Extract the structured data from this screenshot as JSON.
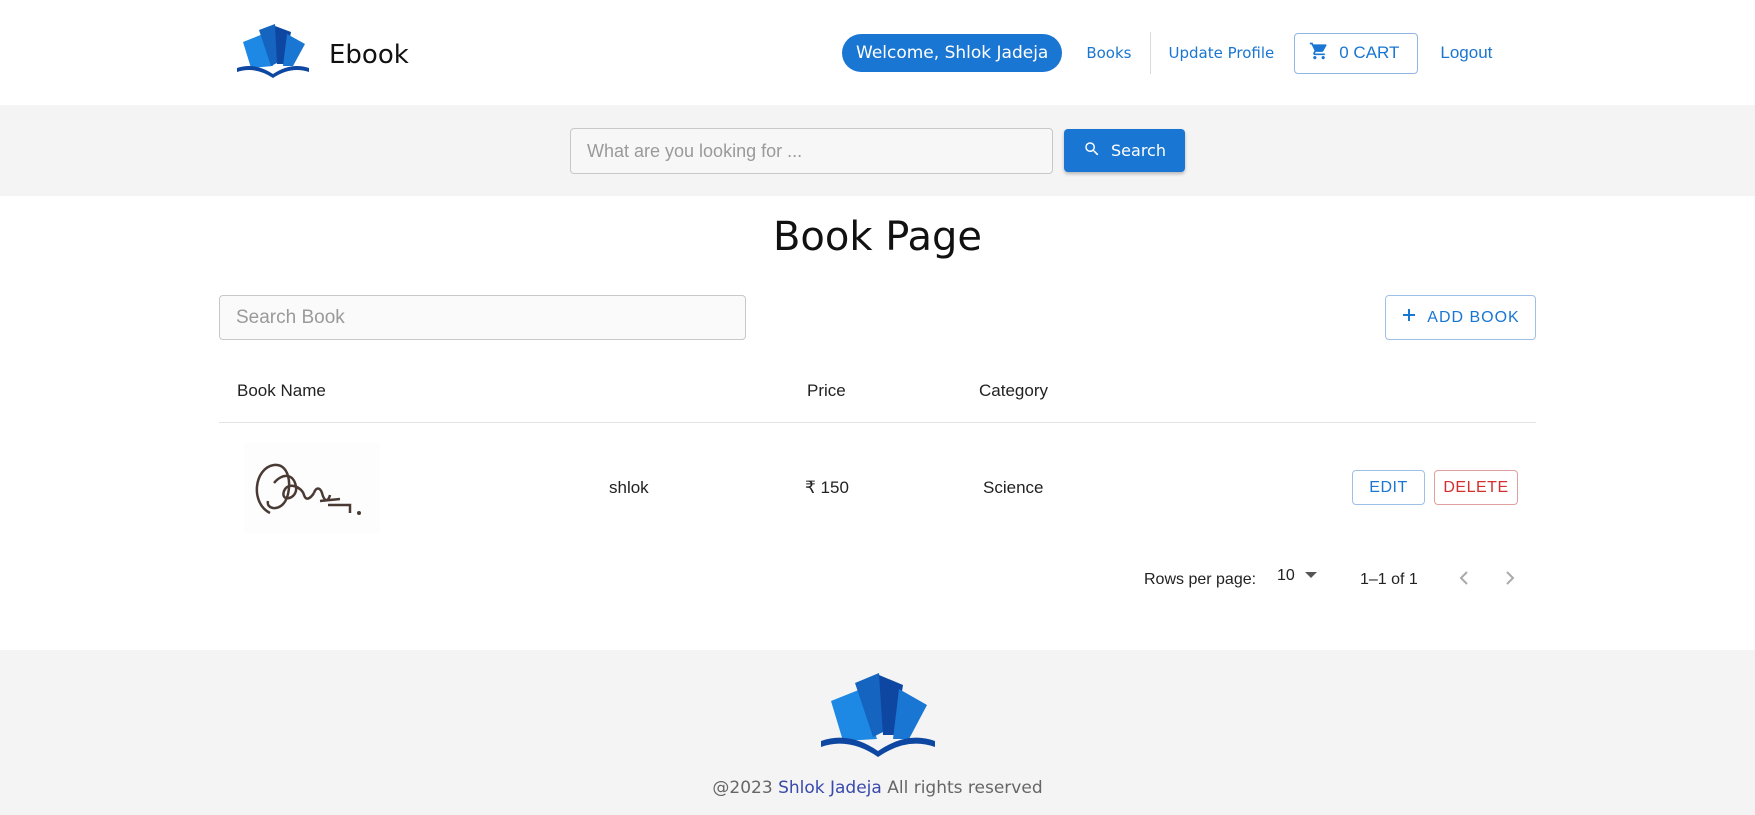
{
  "header": {
    "brand_name": "Ebook",
    "welcome_text": "Welcome, Shlok Jadeja",
    "nav_books": "Books",
    "nav_update_profile": "Update Profile",
    "cart_label": "0 CART",
    "logout_label": "Logout"
  },
  "search": {
    "placeholder": "What are you looking for ...",
    "button_label": "Search"
  },
  "main": {
    "title": "Book Page",
    "book_search_placeholder": "Search Book",
    "add_book_label": "ADD BOOK",
    "columns": [
      "Book Name",
      "Price",
      "Category"
    ],
    "rows": [
      {
        "name": "shlok",
        "price": "₹ 150",
        "category": "Science",
        "edit_label": "EDIT",
        "delete_label": "DELETE"
      }
    ]
  },
  "pagination": {
    "rows_per_page_label": "Rows per page:",
    "rows_per_page_value": "10",
    "range_text": "1–1 of 1"
  },
  "footer": {
    "copyright_prefix": "@2023",
    "author": "Shlok Jadeja",
    "copyright_suffix": "All rights reserved"
  },
  "colors": {
    "primary": "#1976d2",
    "danger": "#d32f2f",
    "band_bg": "#f4f4f4"
  },
  "icons": [
    "book-logo-icon",
    "cart-icon",
    "search-icon",
    "plus-icon",
    "chevron-down-icon",
    "chevron-left-icon",
    "chevron-right-icon"
  ]
}
